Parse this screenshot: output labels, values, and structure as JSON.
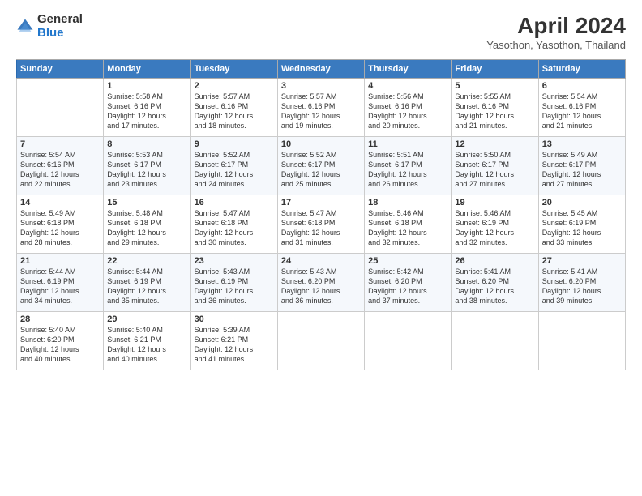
{
  "header": {
    "logo_general": "General",
    "logo_blue": "Blue",
    "title": "April 2024",
    "subtitle": "Yasothon, Yasothon, Thailand"
  },
  "days_of_week": [
    "Sunday",
    "Monday",
    "Tuesday",
    "Wednesday",
    "Thursday",
    "Friday",
    "Saturday"
  ],
  "weeks": [
    [
      {
        "day": "",
        "info": ""
      },
      {
        "day": "1",
        "info": "Sunrise: 5:58 AM\nSunset: 6:16 PM\nDaylight: 12 hours\nand 17 minutes."
      },
      {
        "day": "2",
        "info": "Sunrise: 5:57 AM\nSunset: 6:16 PM\nDaylight: 12 hours\nand 18 minutes."
      },
      {
        "day": "3",
        "info": "Sunrise: 5:57 AM\nSunset: 6:16 PM\nDaylight: 12 hours\nand 19 minutes."
      },
      {
        "day": "4",
        "info": "Sunrise: 5:56 AM\nSunset: 6:16 PM\nDaylight: 12 hours\nand 20 minutes."
      },
      {
        "day": "5",
        "info": "Sunrise: 5:55 AM\nSunset: 6:16 PM\nDaylight: 12 hours\nand 21 minutes."
      },
      {
        "day": "6",
        "info": "Sunrise: 5:54 AM\nSunset: 6:16 PM\nDaylight: 12 hours\nand 21 minutes."
      }
    ],
    [
      {
        "day": "7",
        "info": "Sunrise: 5:54 AM\nSunset: 6:16 PM\nDaylight: 12 hours\nand 22 minutes."
      },
      {
        "day": "8",
        "info": "Sunrise: 5:53 AM\nSunset: 6:17 PM\nDaylight: 12 hours\nand 23 minutes."
      },
      {
        "day": "9",
        "info": "Sunrise: 5:52 AM\nSunset: 6:17 PM\nDaylight: 12 hours\nand 24 minutes."
      },
      {
        "day": "10",
        "info": "Sunrise: 5:52 AM\nSunset: 6:17 PM\nDaylight: 12 hours\nand 25 minutes."
      },
      {
        "day": "11",
        "info": "Sunrise: 5:51 AM\nSunset: 6:17 PM\nDaylight: 12 hours\nand 26 minutes."
      },
      {
        "day": "12",
        "info": "Sunrise: 5:50 AM\nSunset: 6:17 PM\nDaylight: 12 hours\nand 27 minutes."
      },
      {
        "day": "13",
        "info": "Sunrise: 5:49 AM\nSunset: 6:17 PM\nDaylight: 12 hours\nand 27 minutes."
      }
    ],
    [
      {
        "day": "14",
        "info": "Sunrise: 5:49 AM\nSunset: 6:18 PM\nDaylight: 12 hours\nand 28 minutes."
      },
      {
        "day": "15",
        "info": "Sunrise: 5:48 AM\nSunset: 6:18 PM\nDaylight: 12 hours\nand 29 minutes."
      },
      {
        "day": "16",
        "info": "Sunrise: 5:47 AM\nSunset: 6:18 PM\nDaylight: 12 hours\nand 30 minutes."
      },
      {
        "day": "17",
        "info": "Sunrise: 5:47 AM\nSunset: 6:18 PM\nDaylight: 12 hours\nand 31 minutes."
      },
      {
        "day": "18",
        "info": "Sunrise: 5:46 AM\nSunset: 6:18 PM\nDaylight: 12 hours\nand 32 minutes."
      },
      {
        "day": "19",
        "info": "Sunrise: 5:46 AM\nSunset: 6:19 PM\nDaylight: 12 hours\nand 32 minutes."
      },
      {
        "day": "20",
        "info": "Sunrise: 5:45 AM\nSunset: 6:19 PM\nDaylight: 12 hours\nand 33 minutes."
      }
    ],
    [
      {
        "day": "21",
        "info": "Sunrise: 5:44 AM\nSunset: 6:19 PM\nDaylight: 12 hours\nand 34 minutes."
      },
      {
        "day": "22",
        "info": "Sunrise: 5:44 AM\nSunset: 6:19 PM\nDaylight: 12 hours\nand 35 minutes."
      },
      {
        "day": "23",
        "info": "Sunrise: 5:43 AM\nSunset: 6:19 PM\nDaylight: 12 hours\nand 36 minutes."
      },
      {
        "day": "24",
        "info": "Sunrise: 5:43 AM\nSunset: 6:20 PM\nDaylight: 12 hours\nand 36 minutes."
      },
      {
        "day": "25",
        "info": "Sunrise: 5:42 AM\nSunset: 6:20 PM\nDaylight: 12 hours\nand 37 minutes."
      },
      {
        "day": "26",
        "info": "Sunrise: 5:41 AM\nSunset: 6:20 PM\nDaylight: 12 hours\nand 38 minutes."
      },
      {
        "day": "27",
        "info": "Sunrise: 5:41 AM\nSunset: 6:20 PM\nDaylight: 12 hours\nand 39 minutes."
      }
    ],
    [
      {
        "day": "28",
        "info": "Sunrise: 5:40 AM\nSunset: 6:20 PM\nDaylight: 12 hours\nand 40 minutes."
      },
      {
        "day": "29",
        "info": "Sunrise: 5:40 AM\nSunset: 6:21 PM\nDaylight: 12 hours\nand 40 minutes."
      },
      {
        "day": "30",
        "info": "Sunrise: 5:39 AM\nSunset: 6:21 PM\nDaylight: 12 hours\nand 41 minutes."
      },
      {
        "day": "",
        "info": ""
      },
      {
        "day": "",
        "info": ""
      },
      {
        "day": "",
        "info": ""
      },
      {
        "day": "",
        "info": ""
      }
    ]
  ]
}
